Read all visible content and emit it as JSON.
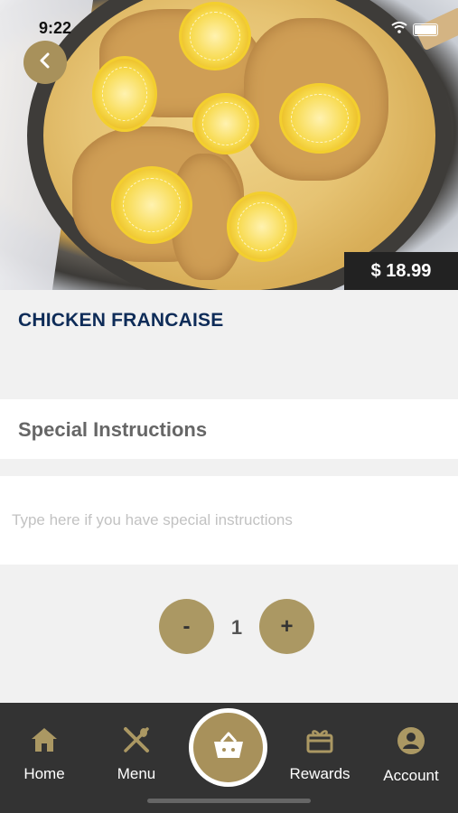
{
  "status_bar": {
    "time": "9:22"
  },
  "item": {
    "name": "CHICKEN FRANCAISE",
    "price": "$ 18.99"
  },
  "special_instructions": {
    "label": "Special Instructions",
    "placeholder": "Type here if you have special instructions",
    "value": ""
  },
  "quantity": {
    "decrement_label": "-",
    "value": "1",
    "increment_label": "+"
  },
  "nav": {
    "items": [
      {
        "label": "Home",
        "icon": "home-icon"
      },
      {
        "label": "Menu",
        "icon": "utensils-icon"
      },
      {
        "label": "",
        "icon": "basket-icon"
      },
      {
        "label": "Rewards",
        "icon": "gift-icon"
      },
      {
        "label": "Account",
        "icon": "account-icon"
      }
    ]
  },
  "colors": {
    "accent_gold": "#a8915b",
    "title_navy": "#0e2c58",
    "nav_bg": "#333333",
    "price_bg": "#222222"
  }
}
